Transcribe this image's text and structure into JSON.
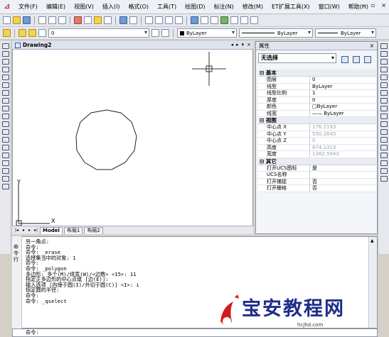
{
  "menu": {
    "items": [
      "文件(F)",
      "编辑(E)",
      "视图(V)",
      "插入(I)",
      "格式(O)",
      "工具(T)",
      "绘图(D)",
      "标注(N)",
      "修改(M)",
      "ET扩展工具(X)",
      "窗口(W)",
      "帮助(H)"
    ],
    "window_buttons": [
      "–",
      "▫",
      "×"
    ]
  },
  "toolbar": {
    "layer_value": "0",
    "color_value": "ByLayer",
    "linetype_value": "ByLayer",
    "lineweight_value": "ByLayer"
  },
  "document": {
    "tab_title": "Drawing2",
    "tab_controls": [
      "◂",
      "▸",
      "▾",
      "×"
    ],
    "axis_x": "X",
    "axis_y": "Y",
    "layout_tabs": [
      "Model",
      "布局1",
      "布局2"
    ],
    "nav_buttons": [
      "|◂",
      "◂",
      "▸",
      "▸|"
    ]
  },
  "properties": {
    "title": "属性",
    "close": "×",
    "selection": "无选择",
    "sections": [
      {
        "name": "基本",
        "rows": [
          {
            "key": "图层",
            "value": "0",
            "gray": false
          },
          {
            "key": "线型",
            "value": "ByLayer",
            "gray": false
          },
          {
            "key": "线型比例",
            "value": "1",
            "gray": false
          },
          {
            "key": "厚度",
            "value": "0",
            "gray": false
          },
          {
            "key": "颜色",
            "value": "□ByLayer",
            "gray": false
          },
          {
            "key": "线宽",
            "value": "—— ByLayer",
            "gray": false
          }
        ]
      },
      {
        "name": "视图",
        "rows": [
          {
            "key": "中心点 X",
            "value": "176.2193",
            "gray": true
          },
          {
            "key": "中心点 Y",
            "value": "550.2645",
            "gray": true
          },
          {
            "key": "中心点 Z",
            "value": "0",
            "gray": true
          },
          {
            "key": "高度",
            "value": "874.1315",
            "gray": true
          },
          {
            "key": "宽度",
            "value": "1382.5943",
            "gray": true
          }
        ]
      },
      {
        "name": "其它",
        "rows": [
          {
            "key": "打开UCS图标",
            "value": "是",
            "gray": false
          },
          {
            "key": "UCS名称",
            "value": "",
            "gray": false
          },
          {
            "key": "打开捕捉",
            "value": "否",
            "gray": false
          },
          {
            "key": "打开栅格",
            "value": "否",
            "gray": false
          }
        ]
      }
    ]
  },
  "command": {
    "side_label": [
      "命",
      "令",
      "行"
    ],
    "lines": [
      "另一角点:",
      "命令:",
      "命令: _erase",
      "选择集当中的对象: 1",
      "命令:",
      "命令: _polygon",
      "多边形: 多个(M)/线宽(W)/<边数> <15>: 11",
      "指定正多边形的中心点或 [边(E)]:",
      "输入选项 [内接于圆(I)/外切于圆(C)] <I>: i",
      "指定圆的半径:",
      "命令:",
      "命令: _qselect"
    ],
    "input_prompt": "命令:"
  },
  "watermark": {
    "text": "宝安教程网",
    "url": "hcjhd.com"
  }
}
